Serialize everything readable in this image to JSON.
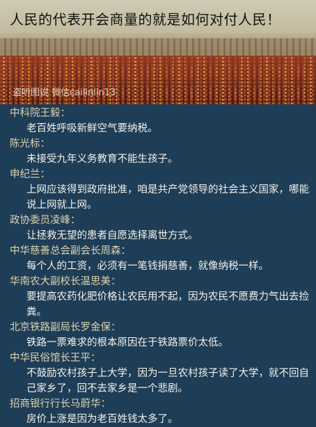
{
  "banner": {
    "title": "人民的代表开会商量的就是如何对付人民！",
    "watermark": "盗听图说  微信cailinlin13"
  },
  "entries": [
    {
      "speaker": "中科院王毅：",
      "quote": "老百姓呼吸新鲜空气要纳税。"
    },
    {
      "speaker": "陈光标：",
      "quote": "未接受九年义务教育不能生孩子。"
    },
    {
      "speaker": "申纪兰：",
      "quote": "上网应该得到政府批准，咱是共产党领导的社会主义国家，哪能说上网就上网。"
    },
    {
      "speaker": "政协委员凌峰：",
      "quote": "让拯救无望的患者自愿选择离世方式。"
    },
    {
      "speaker": "中华慈善总会副会长周森：",
      "quote": "每个人的工资，必须有一笔钱捐慈善，就像纳税一样。"
    },
    {
      "speaker": "华南农大副校长温思美：",
      "quote": "要提高农药化肥价格让农民用不起，因为农民不愿费力气出去捡粪。"
    },
    {
      "speaker": "北京铁路副局长罗金保：",
      "quote": "铁路一票难求的根本原因在于铁路票价太低。"
    },
    {
      "speaker": "中华民俗馆长王平：",
      "quote": "不鼓励农村孩子上大学，因为一旦农村孩子读了大学，就不回自己家乡了，回不去家乡是一个悲剧。"
    },
    {
      "speaker": "招商银行行长马蔚华：",
      "quote": "房价上涨是因为老百姓钱太多了。"
    }
  ]
}
